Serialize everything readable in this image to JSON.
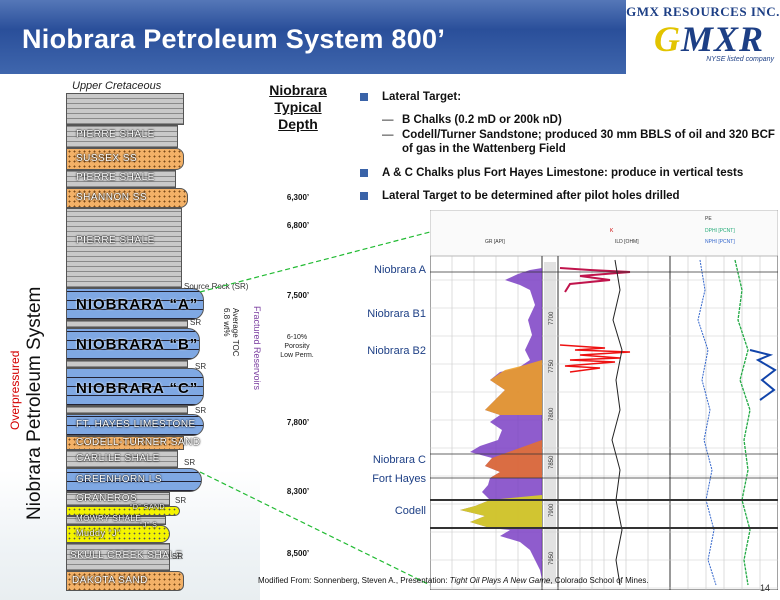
{
  "header": {
    "title": "Niobrara Petroleum System 800’"
  },
  "logo": {
    "company": "GMX RESOURCES INC.",
    "mark_g": "G",
    "mark_rest": "MXR",
    "tagline": "NYSE listed company"
  },
  "column": {
    "period_label": "Upper Cretaceous",
    "layers": {
      "pierre1": "PIERRE SHALE",
      "sussex": "SUSSEX SS",
      "pierre2": "PIERRE SHALE",
      "shannon": "SHANNON SS",
      "pierre3": "PIERRE SHALE",
      "nio_a": "NIOBRARA “A”",
      "nio_b": "NIOBRARA “B”",
      "nio_c": "NIOBRARA “C”",
      "fthayes": "FT. HAYES LIMESTONE",
      "codell": "CODELL-TURNER SAND",
      "carlile": "CARLILE SHALE",
      "greenhorn": "GREENHORN LS",
      "graneros": "GRANEROS",
      "d_sand": "“D” SAND",
      "mowry": "MOWRY SHALE",
      "j_sand": "“J” S",
      "muddy": "Muddy “J”",
      "skull": "SKULL CREEK SHALE",
      "dakota": "DAKOTA SAND"
    },
    "source_rock": "Source Rock (SR)",
    "sr": "SR",
    "side_left_top": "Overpressured",
    "side_left_main": "Niobrara Petroleum System",
    "toc_line1": "Average TOC",
    "toc_line2": "6.8 wt%",
    "fractured": "Fractured Reservoirs"
  },
  "typical_depth": {
    "heading_l1": "Niobrara",
    "heading_l2": "Typical",
    "heading_l3": "Depth",
    "d6300": "6,300’",
    "d6800": "6,800’",
    "d7500": "7,500’",
    "porosity_l1": "6-10%",
    "porosity_l2": "Porosity",
    "porosity_l3": "Low Perm.",
    "d7800": "7,800’",
    "d8300": "8,300’",
    "d8500": "8,500’"
  },
  "bullets": {
    "b1": "Lateral Target:",
    "b1_sub1": "B Chalks (0.2 mD or 200k nD)",
    "b1_sub2": "Codell/Turner Sandstone; produced 30 mm BBLS of oil and 320 BCF of gas in the Wattenberg Field",
    "b2": "A & C Chalks plus Fort Hayes Limestone: produce in vertical tests",
    "b3": "Lateral Target to be determined after pilot holes drilled",
    "dash": "—"
  },
  "log": {
    "labels": {
      "nio_a": "Niobrara A",
      "nio_b1": "Niobrara B1",
      "nio_b2": "Niobrara B2",
      "nio_c": "Niobrara C",
      "fort_hayes": "Fort Hayes",
      "codell": "Codell"
    },
    "curve_headers": {
      "gr": "GR [API]",
      "ild": "ILD [OHM]",
      "k": "K",
      "npe": "NPHI [PCNT]",
      "dphi": "DPHI [PCNT]",
      "pe": "PE"
    },
    "depth_marks": [
      "7700",
      "7750",
      "7800",
      "7850",
      "7900",
      "7950"
    ]
  },
  "credit": {
    "prefix": "Modified From: Sonnenberg, Steven A., Presentation: ",
    "italic": "Tight Oil Plays A New Game",
    "suffix": ", Colorado School of Mines."
  },
  "page_number": "14"
}
